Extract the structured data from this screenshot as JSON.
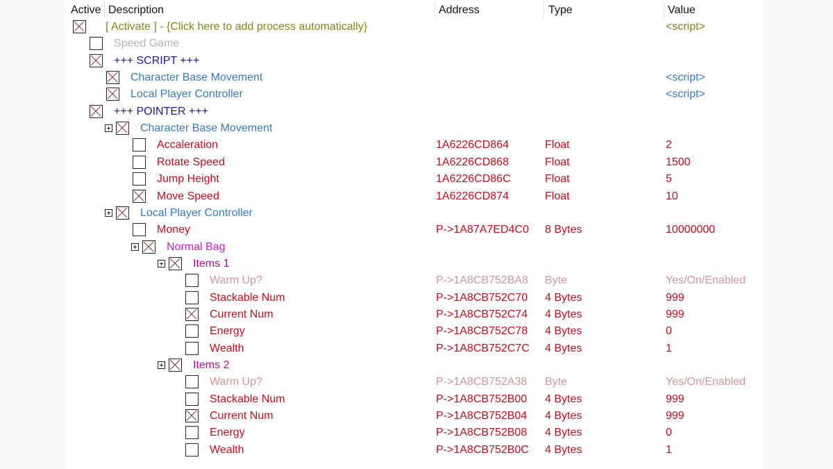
{
  "columns": {
    "active": "Active",
    "description": "Description",
    "address": "Address",
    "type": "Type",
    "value": "Value"
  },
  "colors": {
    "activate": "#84821e",
    "disabled": "#b4b4b4",
    "header": "#1c1c90",
    "script": "#3a78c2",
    "red": "#b8101e",
    "faded": "#d4949c",
    "magenta": "#c21cc8",
    "purple": "#a3128c"
  },
  "rows": [
    {
      "depth": 0,
      "checked": true,
      "expand": false,
      "desc": "[ Activate ] - {Click here to add process automatically}",
      "address": "",
      "type": "",
      "value": "<script>",
      "color": "activate"
    },
    {
      "depth": 1,
      "checked": false,
      "expand": false,
      "desc": "Speed Game",
      "address": "",
      "type": "",
      "value": "",
      "color": "disabled"
    },
    {
      "depth": 1,
      "checked": true,
      "expand": false,
      "desc": "+++ SCRIPT +++",
      "address": "",
      "type": "",
      "value": "",
      "color": "header"
    },
    {
      "depth": 2,
      "checked": true,
      "expand": false,
      "desc": "Character Base Movement",
      "address": "",
      "type": "",
      "value": "<script>",
      "color": "script"
    },
    {
      "depth": 2,
      "checked": true,
      "expand": false,
      "desc": "Local Player Controller",
      "address": "",
      "type": "",
      "value": "<script>",
      "color": "script"
    },
    {
      "depth": 1,
      "checked": true,
      "expand": false,
      "desc": "+++ POINTER +++",
      "address": "",
      "type": "",
      "value": "",
      "color": "header"
    },
    {
      "depth": 2,
      "checked": true,
      "expand": true,
      "desc": "Character Base Movement",
      "address": "",
      "type": "",
      "value": "",
      "color": "script"
    },
    {
      "depth": 3,
      "checked": false,
      "expand": false,
      "desc": "Accaleration",
      "address": "1A6226CD864",
      "type": "Float",
      "value": "2",
      "color": "red"
    },
    {
      "depth": 3,
      "checked": false,
      "expand": false,
      "desc": "Rotate Speed",
      "address": "1A6226CD868",
      "type": "Float",
      "value": "1500",
      "color": "red"
    },
    {
      "depth": 3,
      "checked": false,
      "expand": false,
      "desc": "Jump Height",
      "address": "1A6226CD86C",
      "type": "Float",
      "value": "5",
      "color": "red"
    },
    {
      "depth": 3,
      "checked": true,
      "expand": false,
      "desc": "Move Speed",
      "address": "1A6226CD874",
      "type": "Float",
      "value": "10",
      "color": "red"
    },
    {
      "depth": 2,
      "checked": true,
      "expand": true,
      "desc": "Local Player Controller",
      "address": "",
      "type": "",
      "value": "",
      "color": "script"
    },
    {
      "depth": 3,
      "checked": false,
      "expand": false,
      "desc": "Money",
      "address": "P->1A87A7ED4C0",
      "type": "8 Bytes",
      "value": "10000000",
      "color": "red"
    },
    {
      "depth": 3,
      "checked": true,
      "expand": true,
      "desc": "Normal Bag",
      "address": "",
      "type": "",
      "value": "",
      "color": "magenta"
    },
    {
      "depth": 4,
      "checked": true,
      "expand": true,
      "desc": "Items 1",
      "address": "",
      "type": "",
      "value": "",
      "color": "purple"
    },
    {
      "depth": 5,
      "checked": false,
      "expand": false,
      "desc": "Warm Up?",
      "address": "P->1A8CB752BA8",
      "type": "Byte",
      "value": "Yes/On/Enabled",
      "color": "faded"
    },
    {
      "depth": 5,
      "checked": false,
      "expand": false,
      "desc": "Stackable Num",
      "address": "P->1A8CB752C70",
      "type": "4 Bytes",
      "value": "999",
      "color": "red"
    },
    {
      "depth": 5,
      "checked": true,
      "expand": false,
      "desc": "Current Num",
      "address": "P->1A8CB752C74",
      "type": "4 Bytes",
      "value": "999",
      "color": "red"
    },
    {
      "depth": 5,
      "checked": false,
      "expand": false,
      "desc": "Energy",
      "address": "P->1A8CB752C78",
      "type": "4 Bytes",
      "value": "0",
      "color": "red"
    },
    {
      "depth": 5,
      "checked": false,
      "expand": false,
      "desc": "Wealth",
      "address": "P->1A8CB752C7C",
      "type": "4 Bytes",
      "value": "1",
      "color": "red"
    },
    {
      "depth": 4,
      "checked": true,
      "expand": true,
      "desc": "Items 2",
      "address": "",
      "type": "",
      "value": "",
      "color": "purple"
    },
    {
      "depth": 5,
      "checked": false,
      "expand": false,
      "desc": "Warm Up?",
      "address": "P->1A8CB752A38",
      "type": "Byte",
      "value": "Yes/On/Enabled",
      "color": "faded"
    },
    {
      "depth": 5,
      "checked": false,
      "expand": false,
      "desc": "Stackable Num",
      "address": "P->1A8CB752B00",
      "type": "4 Bytes",
      "value": "999",
      "color": "red"
    },
    {
      "depth": 5,
      "checked": true,
      "expand": false,
      "desc": "Current Num",
      "address": "P->1A8CB752B04",
      "type": "4 Bytes",
      "value": "999",
      "color": "red"
    },
    {
      "depth": 5,
      "checked": false,
      "expand": false,
      "desc": "Energy",
      "address": "P->1A8CB752B08",
      "type": "4 Bytes",
      "value": "0",
      "color": "red"
    },
    {
      "depth": 5,
      "checked": false,
      "expand": false,
      "desc": "Wealth",
      "address": "P->1A8CB752B0C",
      "type": "4 Bytes",
      "value": "1",
      "color": "red"
    }
  ]
}
